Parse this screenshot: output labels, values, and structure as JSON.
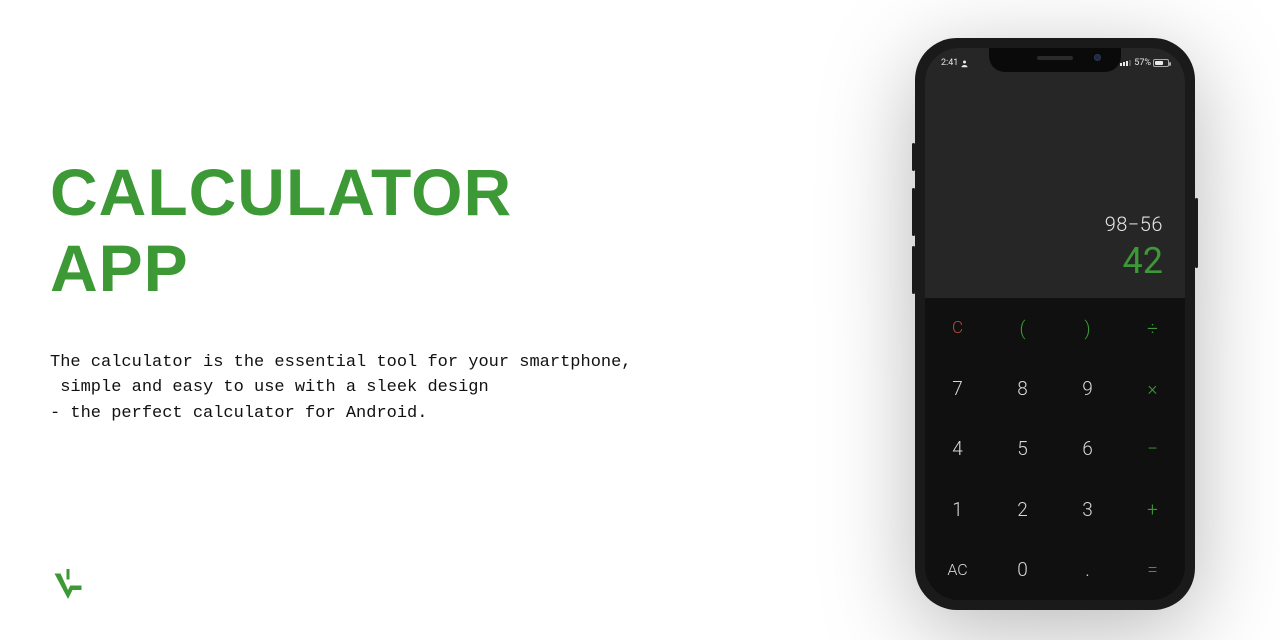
{
  "title": {
    "line1": "CALCULATOR",
    "line2": "APP"
  },
  "description": "The calculator is the essential tool for your smartphone,\n simple and easy to use with a sleek design\n- the perfect calculator for Android.",
  "colors": {
    "accent": "#3c9935"
  },
  "phone": {
    "status": {
      "time": "2:41",
      "battery_pct": "57%"
    },
    "calc": {
      "expression": "98−56",
      "result": "42",
      "keys": {
        "r0": {
          "c": "C",
          "lp": "(",
          "rp": ")",
          "div": "÷"
        },
        "r1": {
          "k7": "7",
          "k8": "8",
          "k9": "9",
          "mul": "×"
        },
        "r2": {
          "k4": "4",
          "k5": "5",
          "k6": "6",
          "sub": "−"
        },
        "r3": {
          "k1": "1",
          "k2": "2",
          "k3": "3",
          "add": "+"
        },
        "r4": {
          "ac": "AC",
          "k0": "0",
          "dot": ".",
          "eq": "="
        }
      }
    }
  }
}
